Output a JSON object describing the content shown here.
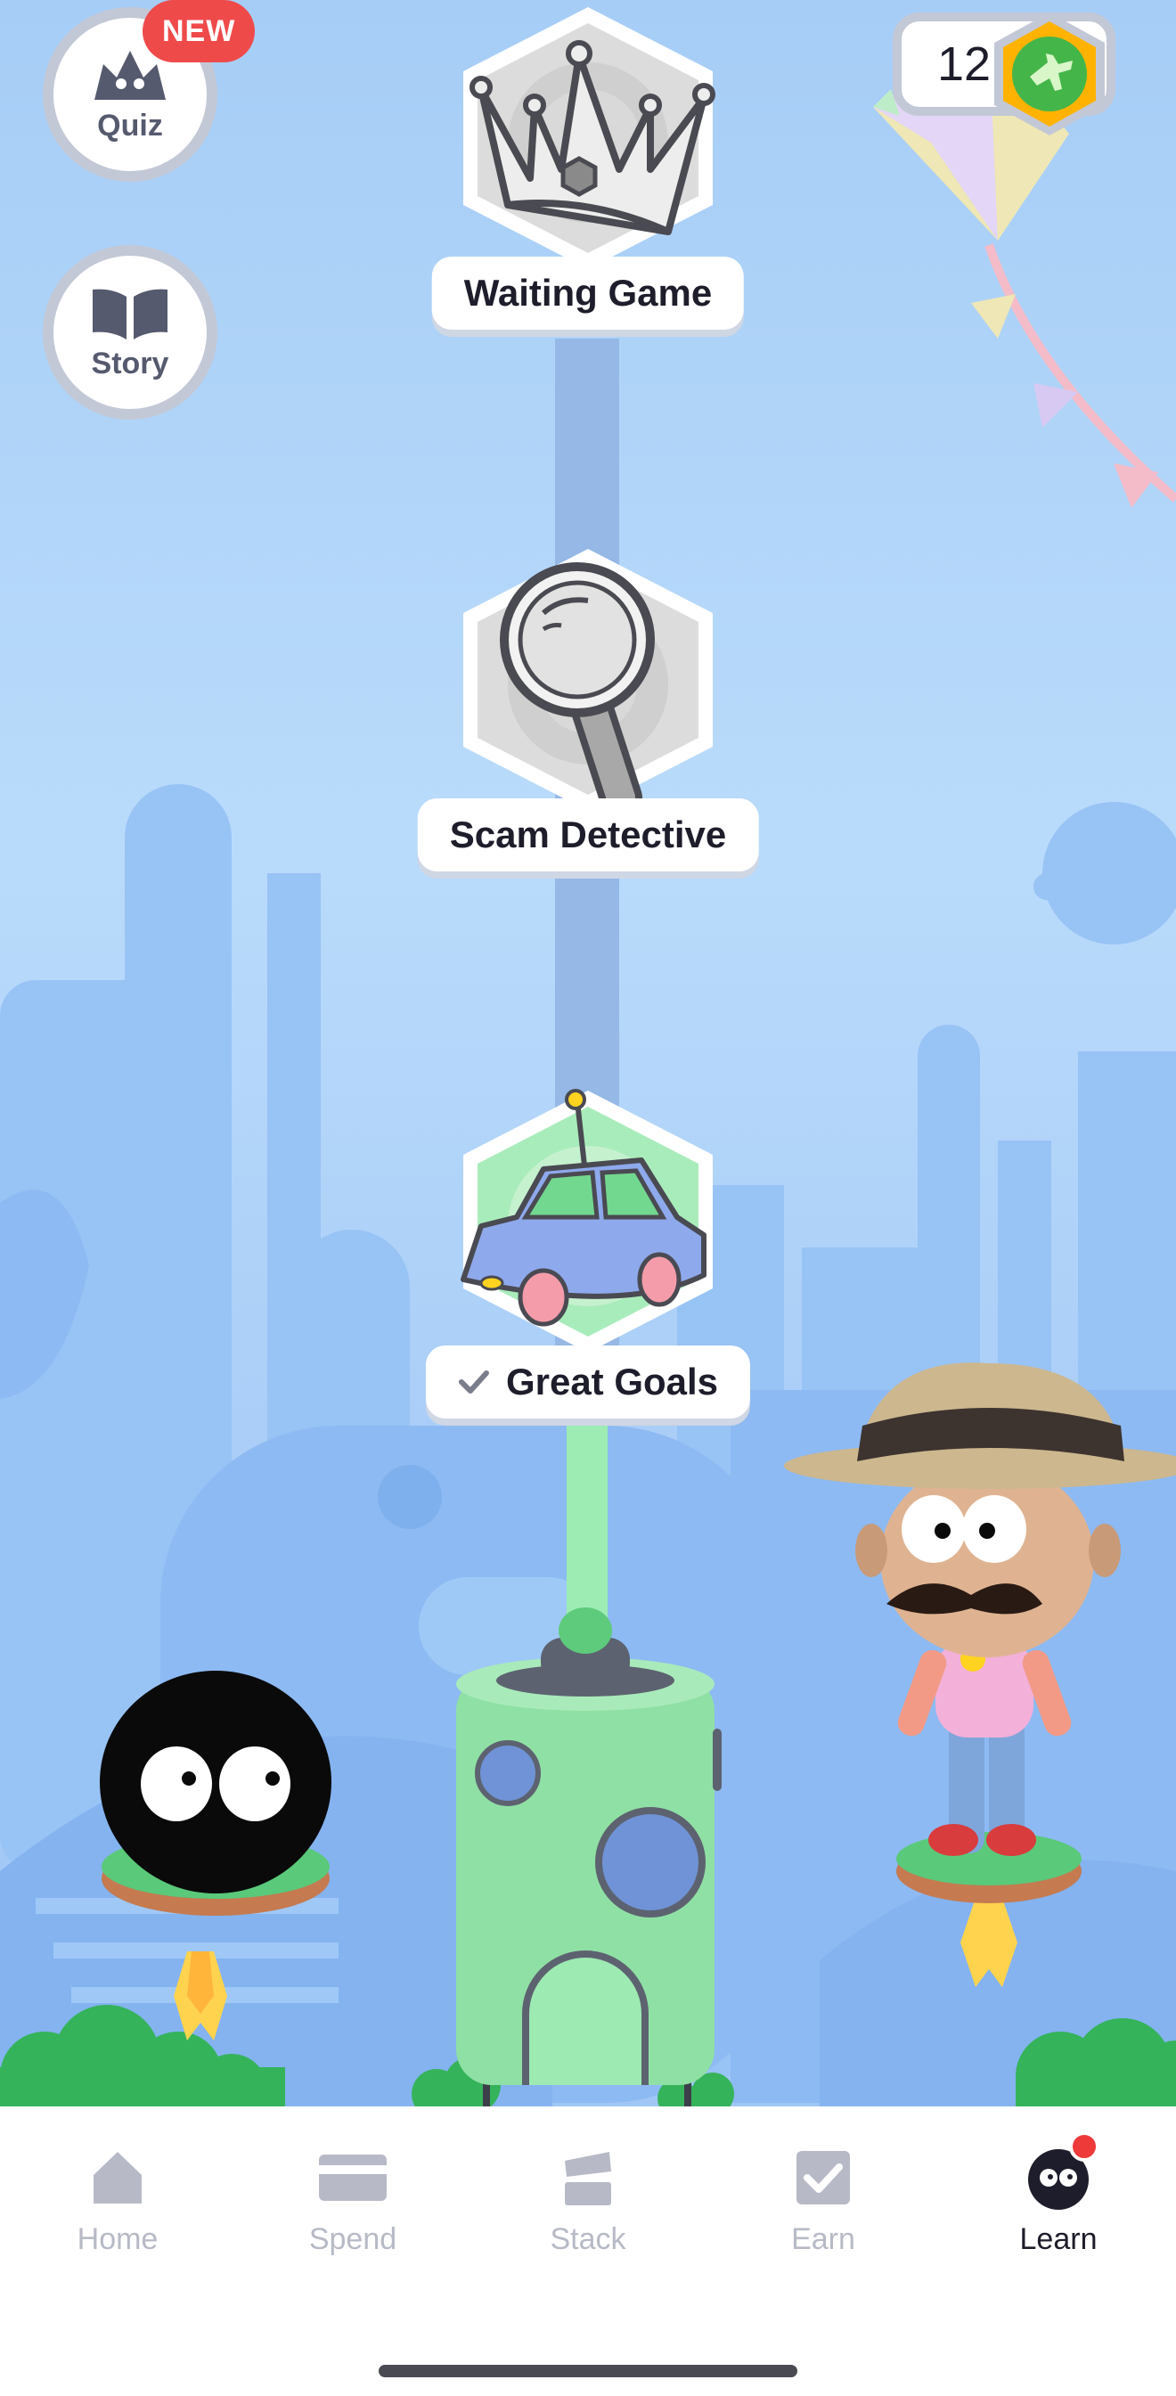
{
  "side_buttons": {
    "quiz": {
      "label": "Quiz",
      "badge": "NEW"
    },
    "story": {
      "label": "Story"
    }
  },
  "coins": {
    "count": "12"
  },
  "levels": [
    {
      "title": "Waiting Game",
      "completed": false,
      "icon": "crown-icon"
    },
    {
      "title": "Scam Detective",
      "completed": false,
      "icon": "magnifier-icon"
    },
    {
      "title": "Great Goals",
      "completed": true,
      "icon": "toy-car-icon"
    }
  ],
  "tabbar": {
    "tabs": [
      {
        "label": "Home",
        "icon": "home-icon",
        "active": false
      },
      {
        "label": "Spend",
        "icon": "card-icon",
        "active": false
      },
      {
        "label": "Stack",
        "icon": "stack-icon",
        "active": false
      },
      {
        "label": "Earn",
        "icon": "checkbox-icon",
        "active": false
      },
      {
        "label": "Learn",
        "icon": "learn-blob-icon",
        "active": true
      }
    ]
  },
  "colors": {
    "sky": "#a6cdf6",
    "city": "#8fbcf3",
    "badge_red": "#ef4a4a",
    "active_tab": "#1d1d2b",
    "inactive_tab": "#b7bac6",
    "tower_green": "#8fe0a4"
  }
}
